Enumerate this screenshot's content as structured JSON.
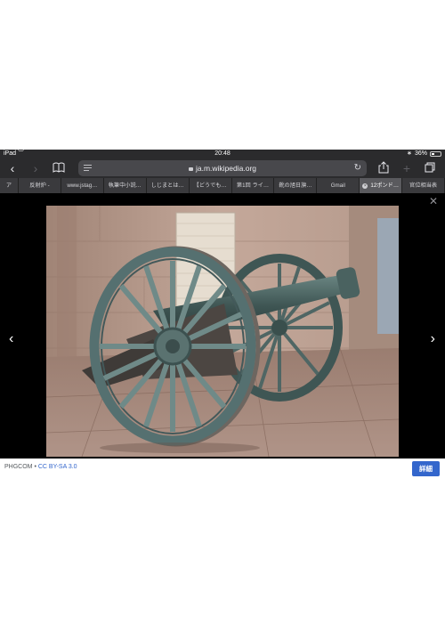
{
  "status_bar": {
    "device": "iPad",
    "time": "20:48",
    "battery": "36%"
  },
  "toolbar": {
    "url": "ja.m.wikipedia.org"
  },
  "tabs": [
    {
      "label": "ア"
    },
    {
      "label": "反射炉 -"
    },
    {
      "label": "www.jstag…"
    },
    {
      "label": "執筆中小説…"
    },
    {
      "label": "しじまとは…"
    },
    {
      "label": "【どうでも…"
    },
    {
      "label": "第1回 ライ…"
    },
    {
      "label": "靴の旭日旗…"
    },
    {
      "label": "Gmail"
    },
    {
      "label": "12ポンド…",
      "active": true
    },
    {
      "label": "官位相当表"
    }
  ],
  "viewer": {
    "attribution_author": "PHGCOM",
    "attribution_separator": " • ",
    "license": "CC BY-SA 3.0",
    "details_button": "詳細"
  }
}
